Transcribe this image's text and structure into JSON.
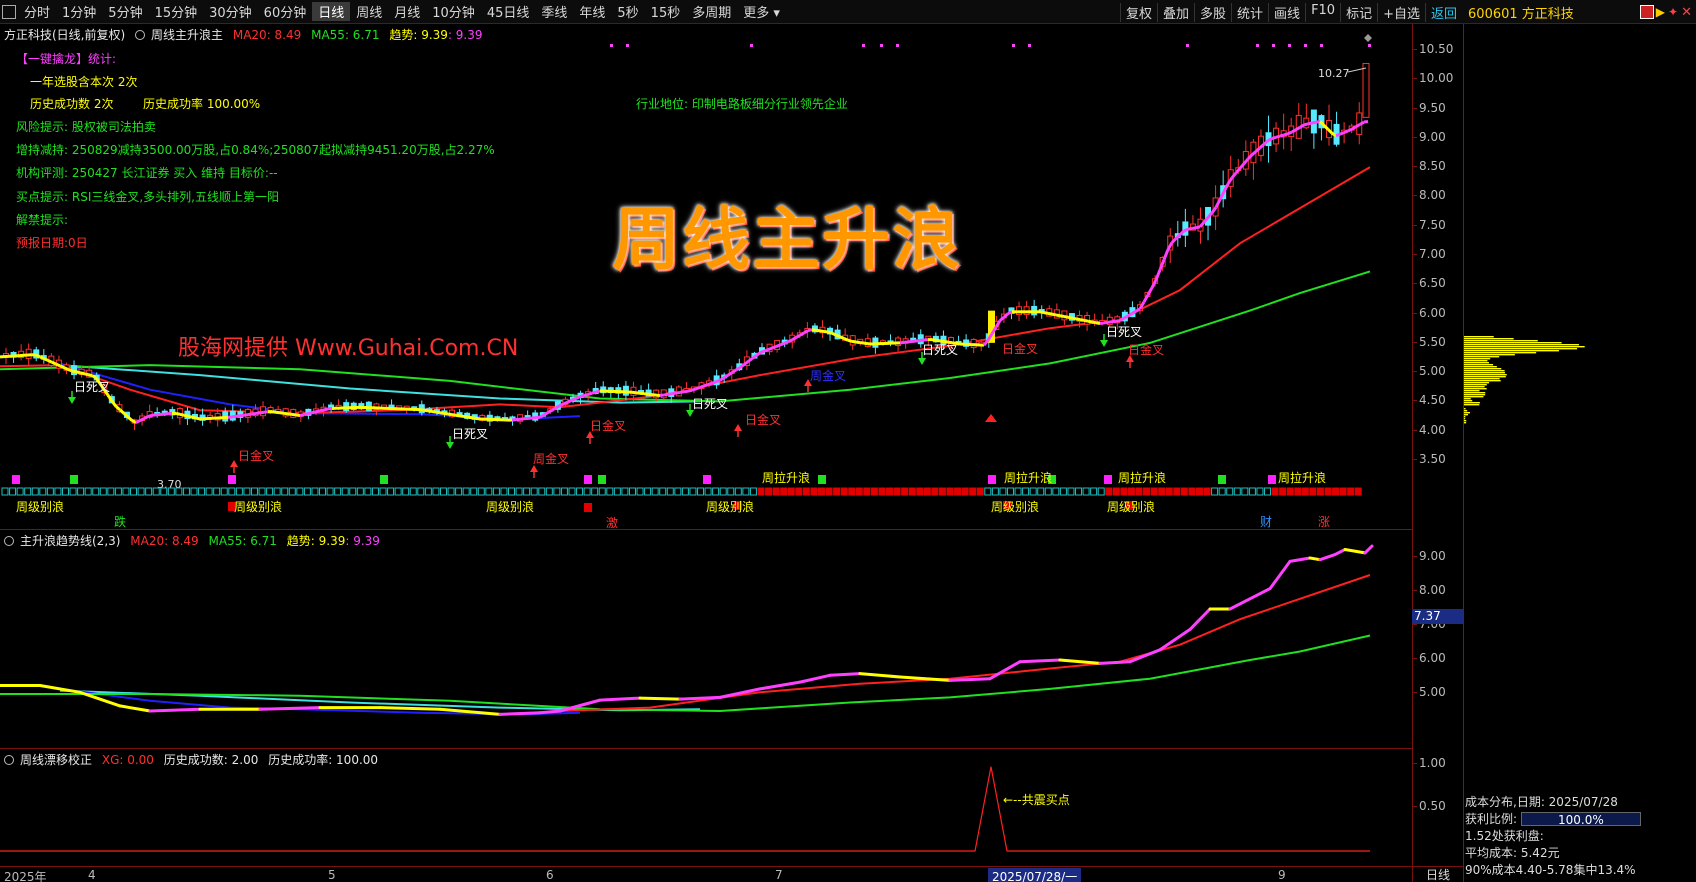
{
  "toolbar": {
    "periods": [
      "分时",
      "1分钟",
      "5分钟",
      "15分钟",
      "30分钟",
      "60分钟",
      "日线",
      "周线",
      "月线",
      "10分钟",
      "45日线",
      "季线",
      "年线",
      "5秒",
      "15秒",
      "多周期",
      "更多"
    ],
    "active_period": "日线",
    "right_buttons": [
      "复权",
      "叠加",
      "多股",
      "统计",
      "画线",
      "F10",
      "标记",
      "+自选"
    ],
    "back_label": "返回",
    "stock_code": "600601 方正科技"
  },
  "main_pane": {
    "title": "方正科技(日线,前复权)",
    "indicator": "周线主升浪主",
    "ma20_label": "MA20: 8.49",
    "ma55_label": "MA55: 6.71",
    "trend_label": "趋势: 9.39",
    "trend_value2": ": 9.39",
    "big_title": "周线主升浪",
    "watermark": "股海网提供 Www.Guhai.Com.CN",
    "info_lines": {
      "one_click": "【一键擒龙】统计:",
      "select_count": "一年选股含本次 2次",
      "success_count": "历史成功数 2次",
      "success_rate": "历史成功率 100.00%",
      "industry": "行业地位: 印制电路板细分行业领先企业",
      "risk": "风险提示: 股权被司法拍卖",
      "holding": "增持减持: 250829减持3500.00万股,占0.84%;250807起拟减持9451.20万股,占2.27%",
      "rating": "机构评测: 250427 长江证券 买入 维持 目标价:--",
      "buy": "买点提示: RSI三线金叉,多头排列,五线顺上第一阳",
      "unlock": "解禁提示:",
      "forecast": "预报日期:0日"
    },
    "labels": {
      "day_dead": "日死叉",
      "day_gold": "日金叉",
      "week_gold": "周金叉",
      "week_apart": "周级别浪",
      "week_pull": "周拉升浪",
      "low_price": "3.70",
      "high_price": "10.27",
      "die": "跌",
      "ji": "激",
      "cai": "财",
      "zhang": "涨"
    },
    "axis_ticks": [
      "10.50",
      "10.00",
      "9.50",
      "9.00",
      "8.50",
      "8.00",
      "7.50",
      "7.00",
      "6.50",
      "6.00",
      "5.50",
      "5.00",
      "4.50",
      "4.00",
      "3.50"
    ]
  },
  "sub_pane1": {
    "title": "主升浪趋势线(2,3)",
    "ma20_label": "MA20: 8.49",
    "ma55_label": "MA55: 6.71",
    "trend_label": "趋势: 9.39",
    "trend_value2": ": 9.39",
    "axis_ticks": [
      "9.00",
      "8.00",
      "7.00",
      "6.00",
      "5.00"
    ],
    "crosshair_value": "7.37"
  },
  "sub_pane2": {
    "title": "周线漂移校正",
    "xg_label": "XG: 0.00",
    "success_count_label": "历史成功数: 2.00",
    "success_rate_label": "历史成功率: 100.00",
    "annotation": "←--共震买点",
    "axis_ticks": [
      "1.00",
      "0.50"
    ]
  },
  "date_axis": {
    "labels": [
      "2025年",
      "4",
      "5",
      "6",
      "7",
      "9"
    ],
    "selected_date": "2025/07/28/一",
    "period": "日线"
  },
  "cost_panel": {
    "date_line": "成本分布,日期: 2025/07/28",
    "profit_label": "获利比例:",
    "profit_value": "100.0%",
    "profit_price_line": "1.52处获利盘:",
    "avg_cost_line": "平均成本: 5.42元",
    "concentration_line": "90%成本4.40-5.78集中13.4%"
  },
  "colors": {
    "up": "#ff3030",
    "down": "#55eaff",
    "ma20": "#ff2020",
    "ma55": "#20e020",
    "trend_up": "#ff40ff",
    "trend_flat": "#ffff00",
    "blue_line": "#2020ff",
    "cyan_line": "#40e0e0",
    "cost_bar": "#ffff00"
  }
}
